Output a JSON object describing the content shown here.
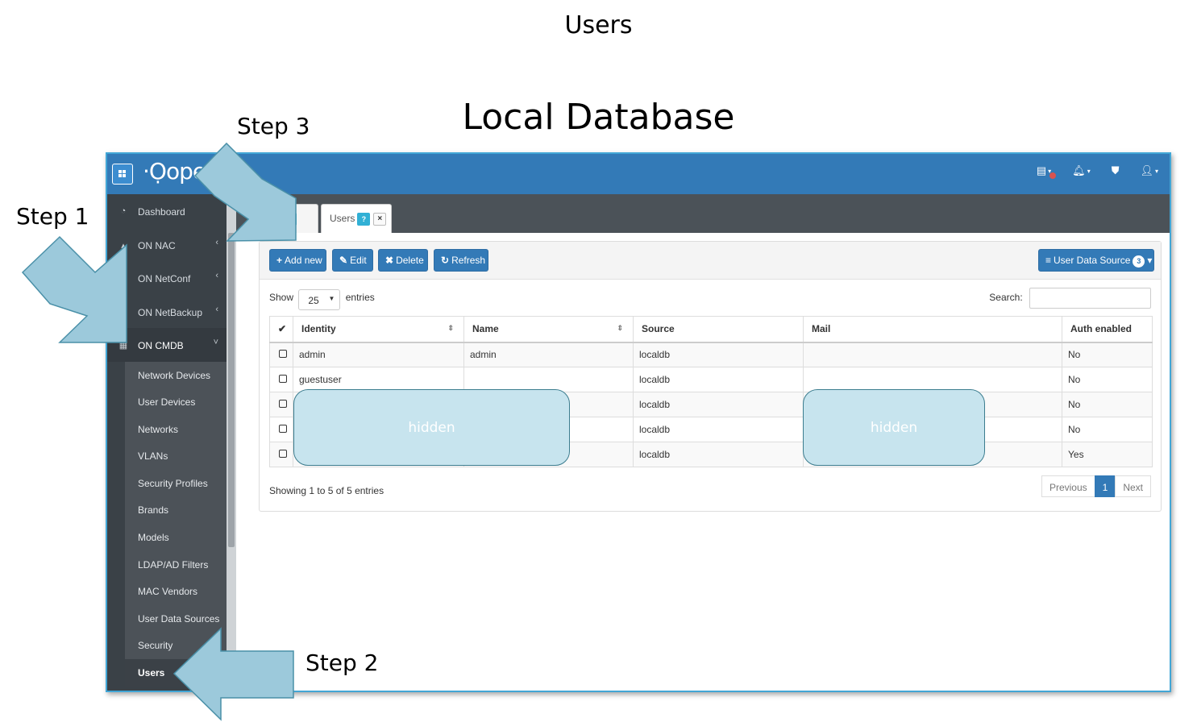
{
  "slide": {
    "title": "Users",
    "subtitle": "Local Database",
    "steps": {
      "step1": "Step 1",
      "step2": "Step 2",
      "step3": "Step 3"
    },
    "redaction_label": "hidden"
  },
  "app": {
    "logo_text": "·Ọope",
    "sidebar": {
      "items": [
        {
          "label": "Dashboard",
          "icon": "dashboard-icon",
          "glyph": "◔"
        },
        {
          "label": "ON NAC",
          "icon": "graduation-cap-icon",
          "glyph": "▴",
          "chevron": "‹"
        },
        {
          "label": "ON NetConf",
          "icon": "server-icon",
          "glyph": "▤",
          "chevron": "‹"
        },
        {
          "label": "ON NetBackup",
          "icon": "backup-icon",
          "glyph": "▥",
          "chevron": "‹"
        },
        {
          "label": "ON CMDB",
          "icon": "table-icon",
          "glyph": "▦",
          "chevron": "˅"
        }
      ],
      "submenu": [
        "Network Devices",
        "User Devices",
        "Networks",
        "VLANs",
        "Security Profiles",
        "Brands",
        "Models",
        "LDAP/AD Filters",
        "MAC Vendors",
        "User Data Sources",
        "Security",
        "Users"
      ]
    },
    "tabs": [
      {
        "label": "l",
        "help": "?"
      },
      {
        "label": "Users",
        "help": "?",
        "close": "×"
      }
    ],
    "toolbar": {
      "add": "Add new",
      "add_icon": "+",
      "edit": "Edit",
      "edit_icon": "✎",
      "delete": "Delete",
      "delete_icon": "✖",
      "refresh": "Refresh",
      "refresh_icon": "↻",
      "source": "User Data Source",
      "source_icon": "≡",
      "source_count": "3",
      "caret": "▾"
    },
    "table": {
      "show_label": "Show",
      "page_size": "25",
      "entries_label": "entries",
      "search_label": "Search:",
      "check_header": "✔",
      "columns": [
        "Identity",
        "Name",
        "Source",
        "Mail",
        "Auth enabled"
      ],
      "rows": [
        {
          "identity": "admin",
          "name": "admin",
          "source": "localdb",
          "mail": "",
          "auth": "No"
        },
        {
          "identity": "guestuser",
          "name": "",
          "source": "localdb",
          "mail": "",
          "auth": "No"
        },
        {
          "identity": "",
          "name": "",
          "source": "localdb",
          "mail": "",
          "auth": "No"
        },
        {
          "identity": "",
          "name": "",
          "source": "localdb",
          "mail": "",
          "auth": "No"
        },
        {
          "identity": "",
          "name": "",
          "source": "localdb",
          "mail": "",
          "auth": "Yes"
        }
      ],
      "summary": "Showing 1 to 5 of 5 entries",
      "pager": {
        "previous": "Previous",
        "current": "1",
        "next": "Next"
      }
    },
    "colors": {
      "topbar": "#337ab7",
      "sidebar": "#3a4147",
      "button": "#337ab7",
      "arrow": "#9cc9db",
      "hidden_box": "#c7e4ee"
    }
  }
}
